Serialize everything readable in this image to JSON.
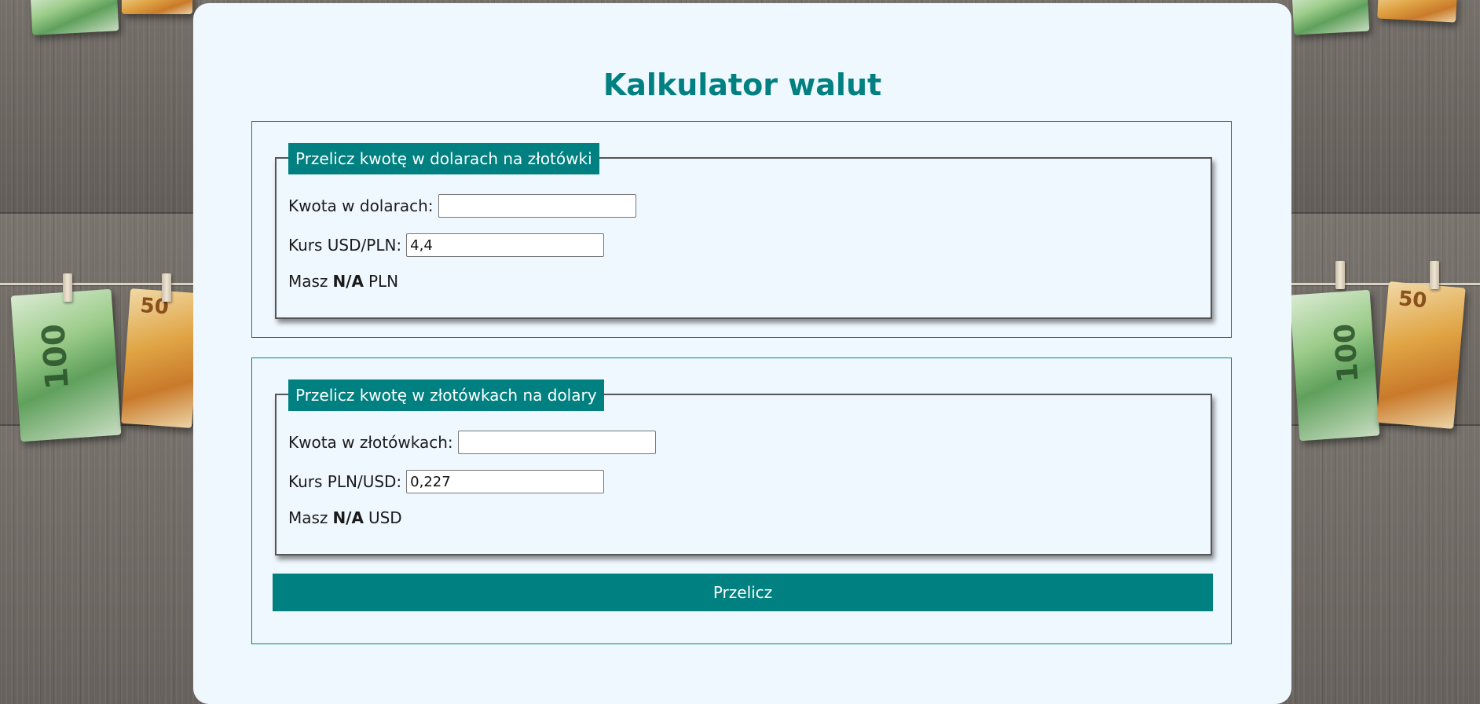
{
  "page": {
    "title": "Kalkulator walut",
    "accent_color": "#008080",
    "card_background": "#f0f8ff"
  },
  "usd_to_pln": {
    "legend": "Przelicz kwotę w dolarach na złotówki",
    "amount_label": "Kwota w dolarach:",
    "amount_value": "",
    "rate_label": "Kurs USD/PLN:",
    "rate_value": "4,4",
    "result_prefix": "Masz",
    "result_value": "N/A",
    "result_currency": "PLN"
  },
  "pln_to_usd": {
    "legend": "Przelicz kwotę w złotówkach na dolary",
    "amount_label": "Kwota w złotówkach:",
    "amount_value": "",
    "rate_label": "Kurs PLN/USD:",
    "rate_value": "0,227",
    "result_prefix": "Masz",
    "result_value": "N/A",
    "result_currency": "USD"
  },
  "convert_button": {
    "label": "Przelicz"
  },
  "background": {
    "description_icon": "banknotes-on-clothesline-background"
  }
}
